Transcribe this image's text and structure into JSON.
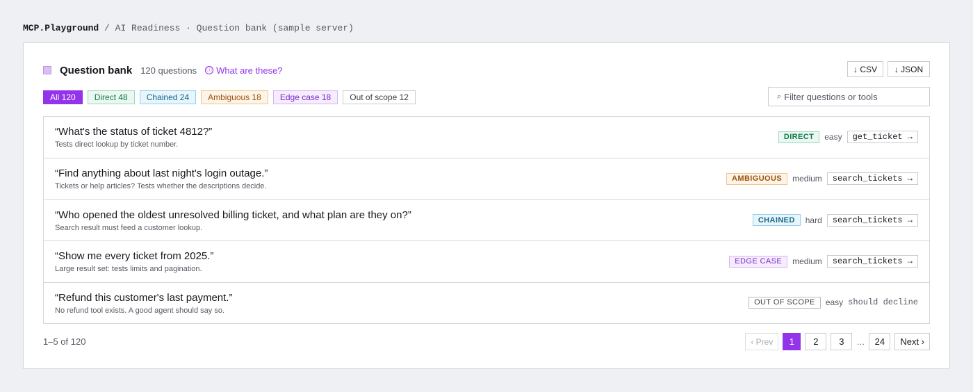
{
  "breadcrumb": {
    "brand": "MCP.Playground",
    "separator": "/",
    "path": "AI Readiness · Question bank (sample server)"
  },
  "header": {
    "title": "Question bank",
    "count": "120 questions",
    "what_link": "What are these?",
    "info_icon": "ⓘ",
    "csv_button": "↓ CSV",
    "json_button": "↓ JSON"
  },
  "filters": [
    {
      "label": "All 120"
    },
    {
      "label": "Direct 48"
    },
    {
      "label": "Chained 24"
    },
    {
      "label": "Ambiguous 18"
    },
    {
      "label": "Edge case 18"
    },
    {
      "label": "Out of scope 12"
    }
  ],
  "search": {
    "icon": "⌕",
    "placeholder": "Filter questions or tools"
  },
  "questions": [
    {
      "question": "“What's the status of ticket 4812?”",
      "description": "Tests direct lookup by ticket number.",
      "tag": "DIRECT",
      "difficulty": "easy",
      "tool": "get_ticket →"
    },
    {
      "question": "“Find anything about last night's login outage.”",
      "description": "Tickets or help articles? Tests whether the descriptions decide.",
      "tag": "AMBIGUOUS",
      "difficulty": "medium",
      "tool": "search_tickets →"
    },
    {
      "question": "“Who opened the oldest unresolved billing ticket, and what plan are they on?”",
      "description": "Search result must feed a customer lookup.",
      "tag": "CHAINED",
      "difficulty": "hard",
      "tool": "search_tickets →"
    },
    {
      "question": "“Show me every ticket from 2025.”",
      "description": "Large result set: tests limits and pagination.",
      "tag": "EDGE CASE",
      "difficulty": "medium",
      "tool": "search_tickets →"
    },
    {
      "question": "“Refund this customer's last payment.”",
      "description": "No refund tool exists. A good agent should say so.",
      "tag": "OUT OF SCOPE",
      "difficulty": "easy",
      "tool": "should decline"
    }
  ],
  "footer": {
    "range": "1–5 of 120",
    "prev": "‹ Prev",
    "pages": [
      "1",
      "2",
      "3"
    ],
    "ellipsis": "…",
    "last_page": "24",
    "next": "Next ›"
  },
  "colors": {
    "accent": "#9333ea",
    "direct": "#127a4e",
    "chained": "#13668a",
    "ambiguous": "#9a5410",
    "edge_case": "#7a2cc4"
  }
}
